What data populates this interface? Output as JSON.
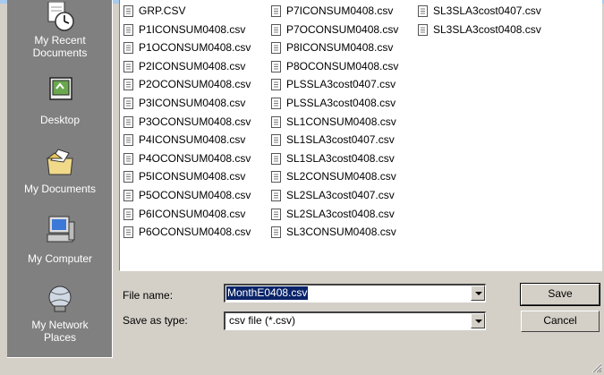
{
  "places": [
    {
      "label": "My Recent\nDocuments",
      "icon": "recent-documents-icon"
    },
    {
      "label": "Desktop",
      "icon": "desktop-icon"
    },
    {
      "label": "My Documents",
      "icon": "my-documents-icon"
    },
    {
      "label": "My Computer",
      "icon": "my-computer-icon"
    },
    {
      "label": "My Network\nPlaces",
      "icon": "my-network-places-icon"
    }
  ],
  "files": {
    "col1": [
      "GRP.CSV",
      "P1ICONSUM0408.csv",
      "P1OCONSUM0408.csv",
      "P2ICONSUM0408.csv",
      "P2OCONSUM0408.csv",
      "P3ICONSUM0408.csv",
      "P3OCONSUM0408.csv",
      "P4ICONSUM0408.csv",
      "P4OCONSUM0408.csv",
      "P5ICONSUM0408.csv",
      "P5OCONSUM0408.csv",
      "P6ICONSUM0408.csv",
      "P6OCONSUM0408.csv"
    ],
    "col2": [
      "P7ICONSUM0408.csv",
      "P7OCONSUM0408.csv",
      "P8ICONSUM0408.csv",
      "P8OCONSUM0408.csv",
      "PLSSLA3cost0407.csv",
      "PLSSLA3cost0408.csv",
      "SL1CONSUM0408.csv",
      "SL1SLA3cost0407.csv",
      "SL1SLA3cost0408.csv",
      "SL2CONSUM0408.csv",
      "SL2SLA3cost0407.csv",
      "SL2SLA3cost0408.csv",
      "SL3CONSUM0408.csv"
    ],
    "col3": [
      "SL3SLA3cost0407.csv",
      "SL3SLA3cost0408.csv"
    ]
  },
  "form": {
    "file_name_label": "File name:",
    "file_name_value": "MonthE0408.csv",
    "save_as_type_label": "Save as type:",
    "save_as_type_value": "csv file (*.csv)"
  },
  "buttons": {
    "save": "Save",
    "cancel": "Cancel"
  },
  "colors": {
    "dialog_bg": "#d4d0c8",
    "places_bar": "#808080",
    "selection": "#0a246a"
  }
}
